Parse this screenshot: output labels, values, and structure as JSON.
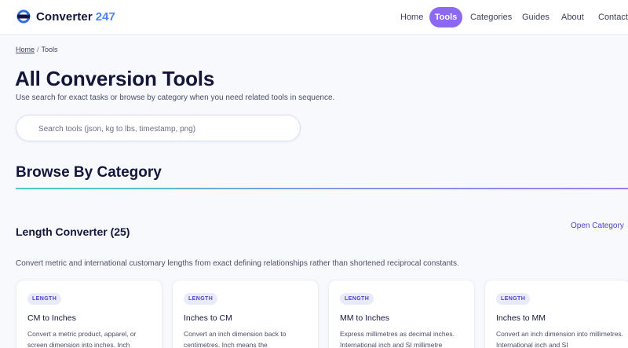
{
  "header": {
    "brand_name": "Converter",
    "brand_number": "247",
    "nav": [
      {
        "label": "Home",
        "active": false
      },
      {
        "label": "Tools",
        "active": true
      },
      {
        "label": "Categories",
        "active": false
      },
      {
        "label": "Guides",
        "active": false
      },
      {
        "label": "About",
        "active": false
      },
      {
        "label": "Contact",
        "active": false
      }
    ]
  },
  "breadcrumb": {
    "home": "Home",
    "separator": "/",
    "current": "Tools"
  },
  "page": {
    "title": "All Conversion Tools",
    "subtitle": "Use search for exact tasks or browse by category when you need related tools in sequence."
  },
  "search": {
    "placeholder": "Search tools (json, kg to lbs, timestamp, png)",
    "value": ""
  },
  "section": {
    "title": "Browse By Category"
  },
  "category": {
    "title": "Length Converter (25)",
    "link_label": "Open Category →",
    "description": "Convert metric and international customary lengths from exact defining relationships rather than shortened reciprocal constants.",
    "cards": [
      {
        "tag": "LENGTH",
        "title": "CM to Inches",
        "description": "Convert a metric product, apparel, or screen dimension into inches. Inch"
      },
      {
        "tag": "LENGTH",
        "title": "Inches to CM",
        "description": "Convert an inch dimension back to centimetres. Inch means the"
      },
      {
        "tag": "LENGTH",
        "title": "MM to Inches",
        "description": "Express millimetres as decimal inches. International inch and SI millimetre"
      },
      {
        "tag": "LENGTH",
        "title": "Inches to MM",
        "description": "Convert an inch dimension into millimetres. International inch and SI"
      }
    ]
  },
  "colors": {
    "accent": "#8d68f2",
    "brand_number": "#4a86f0",
    "link": "#4b43c9"
  }
}
